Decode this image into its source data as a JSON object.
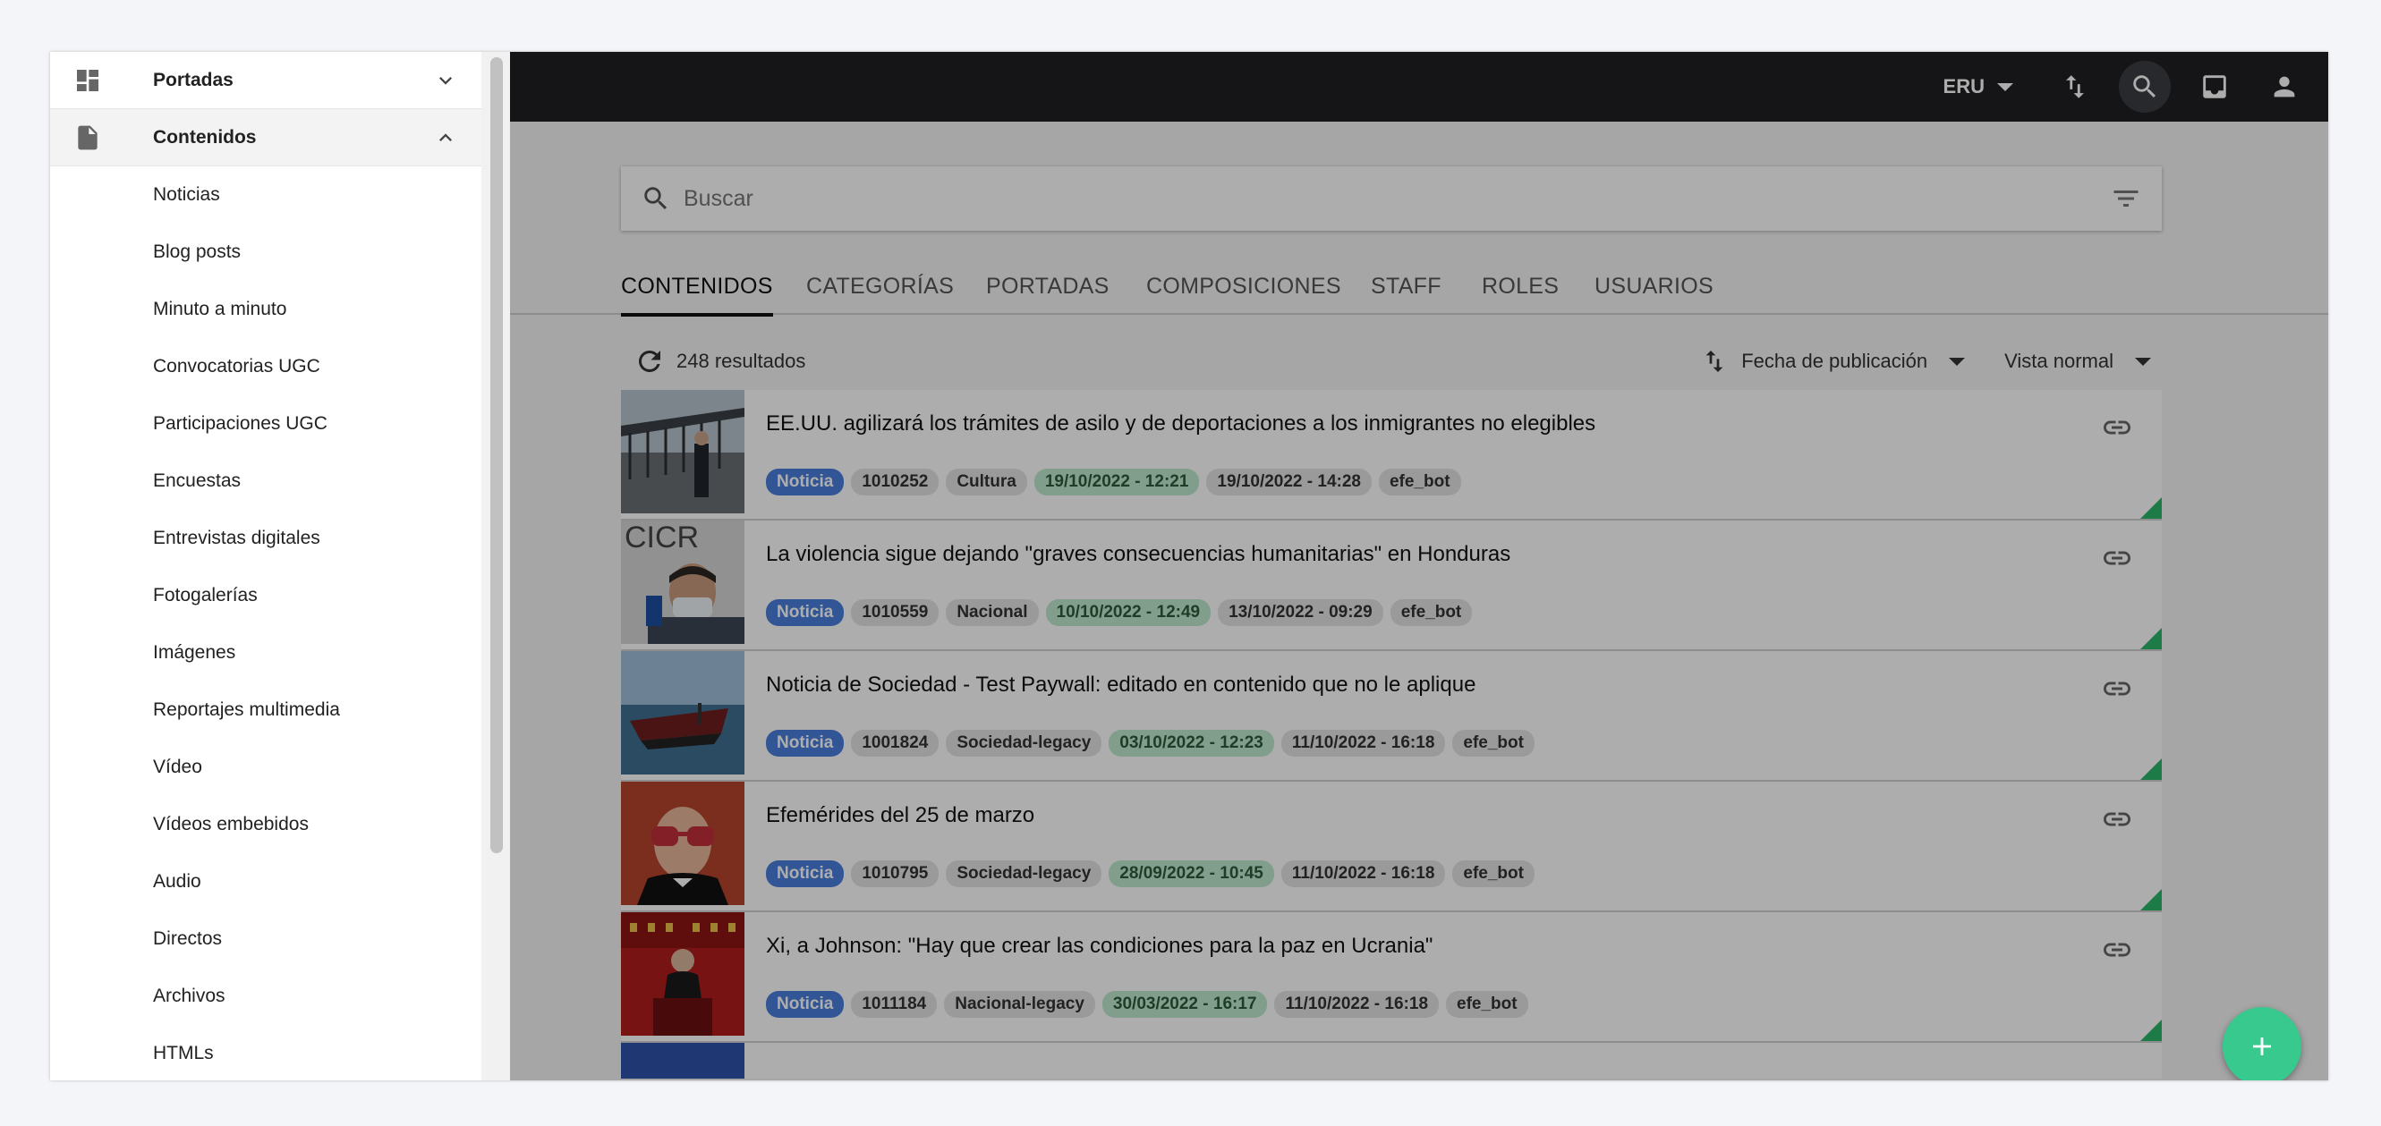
{
  "topbar": {
    "language": "ERU",
    "icons": [
      "sort-arrows-icon",
      "search-icon",
      "inbox-icon",
      "account-icon"
    ]
  },
  "search": {
    "placeholder": "Buscar"
  },
  "tabs": [
    "CONTENIDOS",
    "CATEGORÍAS",
    "PORTADAS",
    "COMPOSICIONES",
    "STAFF",
    "ROLES",
    "USUARIOS"
  ],
  "active_tab": "CONTENIDOS",
  "results": {
    "count": "248 resultados",
    "sort_label": "Fecha de publicación",
    "view_label": "Vista normal"
  },
  "items": [
    {
      "title": "EE.UU. agilizará los trámites de asilo y de deportaciones a los inmigrantes no elegibles",
      "type": "Noticia",
      "id": "1010252",
      "category": "Cultura",
      "published": "19/10/2022 - 12:21",
      "modified": "19/10/2022 - 14:28",
      "author": "efe_bot"
    },
    {
      "title": "La violencia sigue dejando \"graves consecuencias humanitarias\" en Honduras",
      "type": "Noticia",
      "id": "1010559",
      "category": "Nacional",
      "published": "10/10/2022 - 12:49",
      "modified": "13/10/2022 - 09:29",
      "author": "efe_bot"
    },
    {
      "title": "Noticia de Sociedad - Test Paywall: editado en contenido que no le aplique",
      "type": "Noticia",
      "id": "1001824",
      "category": "Sociedad-legacy",
      "published": "03/10/2022 - 12:23",
      "modified": "11/10/2022 - 16:18",
      "author": "efe_bot"
    },
    {
      "title": "Efemérides del 25 de marzo",
      "type": "Noticia",
      "id": "1010795",
      "category": "Sociedad-legacy",
      "published": "28/09/2022 - 10:45",
      "modified": "11/10/2022 - 16:18",
      "author": "efe_bot"
    },
    {
      "title": "Xi, a Johnson: \"Hay que crear las condiciones para la paz en Ucrania\"",
      "type": "Noticia",
      "id": "1011184",
      "category": "Nacional-legacy",
      "published": "30/03/2022 - 16:17",
      "modified": "11/10/2022 - 16:18",
      "author": "efe_bot"
    }
  ],
  "drawer": {
    "sections": [
      {
        "label": "Portadas",
        "icon": "dashboard-icon",
        "expanded": false
      },
      {
        "label": "Contenidos",
        "icon": "document-icon",
        "expanded": true
      }
    ],
    "content_items": [
      "Noticias",
      "Blog posts",
      "Minuto a minuto",
      "Convocatorias UGC",
      "Participaciones UGC",
      "Encuestas",
      "Entrevistas digitales",
      "Fotogalerías",
      "Imágenes",
      "Reportajes multimedia",
      "Vídeo",
      "Vídeos embebidos",
      "Audio",
      "Directos",
      "Archivos",
      "HTMLs"
    ]
  },
  "colors": {
    "topbar": "#1f2024",
    "type_tag": "#4a7fdc",
    "published_tag": "#bfe9cf",
    "fab": "#37c98e",
    "status_corner": "#2bb56a"
  }
}
